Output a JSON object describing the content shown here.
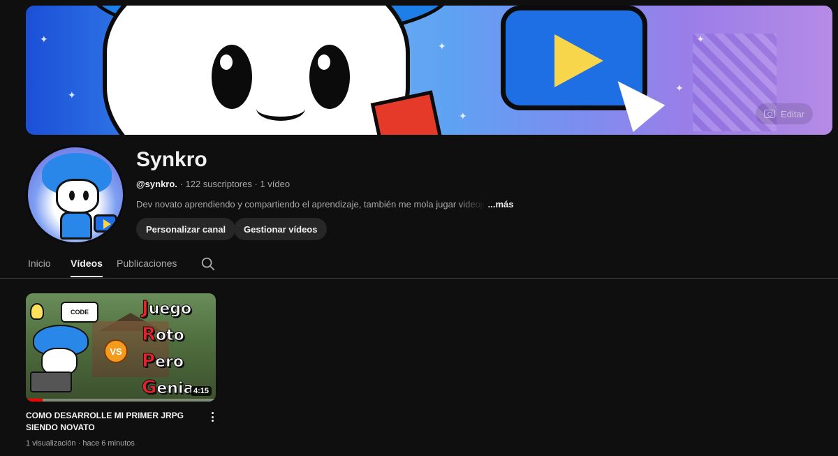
{
  "banner": {
    "edit_label": "Editar"
  },
  "channel": {
    "name": "Synkro",
    "handle": "@synkro.",
    "separator": " · ",
    "subscribers": "122 suscriptores",
    "video_count": "1 vídeo",
    "description": "Dev novato aprendiendo y compartiendo el aprendizaje, también me mola jugar videojuegos",
    "more_label": "...más"
  },
  "buttons": {
    "customize": "Personalizar canal",
    "manage": "Gestionar vídeos"
  },
  "tabs": [
    {
      "label": "Inicio",
      "active": false
    },
    {
      "label": "Vídeos",
      "active": true
    },
    {
      "label": "Publicaciones",
      "active": false
    }
  ],
  "video": {
    "thumbnail_text": {
      "code_bubble": "CODE",
      "vs": "VS",
      "words": [
        "Juego",
        "Roto",
        "Pero",
        "Genia"
      ]
    },
    "duration": "4:15",
    "watched_fraction": 0.09,
    "title": "COMO DESARROLLE MI PRIMER JRPG SIENDO NOVATO",
    "views": "1 visualización",
    "age": "hace 6 minutos"
  },
  "colors": {
    "background": "#0f0f0f",
    "button_bg": "#272727",
    "text_primary": "#f1f1f1",
    "text_secondary": "#aaaaaa",
    "progress_red": "#ff0000"
  },
  "icons": [
    "search-icon",
    "camera-icon",
    "more-vert-icon",
    "play-icon"
  ]
}
